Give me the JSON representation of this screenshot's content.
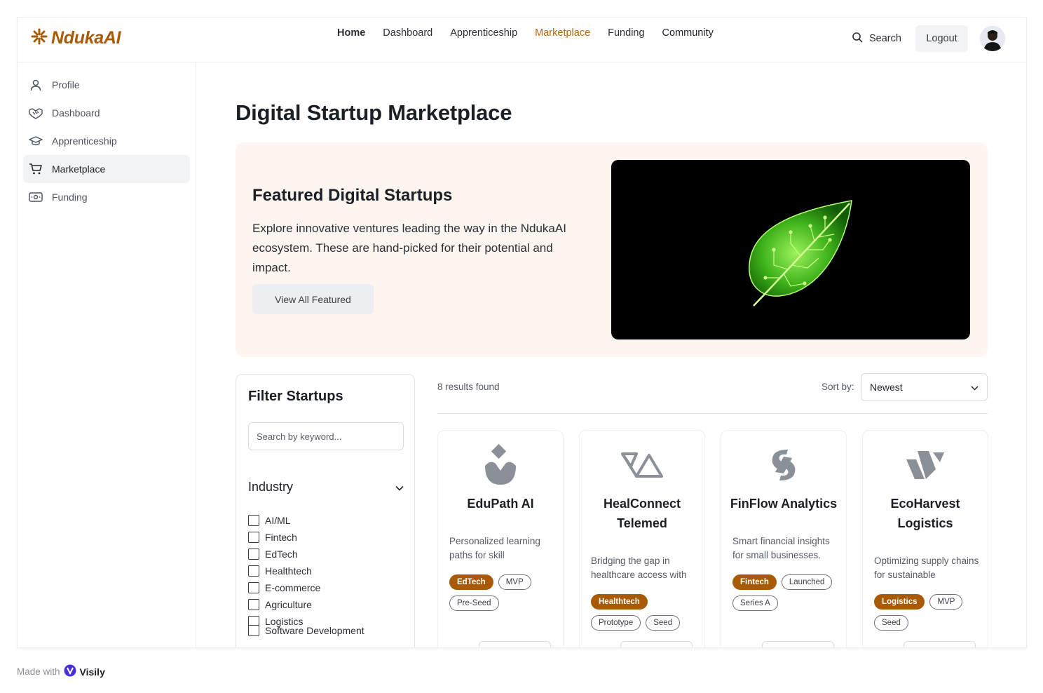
{
  "brand": {
    "name": "NdukaAI",
    "color": "#a85a06"
  },
  "nav": {
    "items": [
      "Home",
      "Dashboard",
      "Apprenticeship",
      "Marketplace",
      "Funding",
      "Community"
    ],
    "active": "Marketplace",
    "search_label": "Search",
    "logout_label": "Logout"
  },
  "sidebar": {
    "items": [
      {
        "label": "Profile",
        "icon": "user-icon"
      },
      {
        "label": "Dashboard",
        "icon": "handshake-icon"
      },
      {
        "label": "Apprenticeship",
        "icon": "graduation-cap-icon"
      },
      {
        "label": "Marketplace",
        "icon": "cart-icon",
        "active": true
      },
      {
        "label": "Funding",
        "icon": "money-icon"
      }
    ]
  },
  "page": {
    "title": "Digital Startup Marketplace"
  },
  "hero": {
    "title": "Featured Digital Startups",
    "description": "Explore innovative ventures leading the way in the NdukaAI ecosystem. These are hand-picked for their potential and impact.",
    "button_label": "View All Featured",
    "image": "circuit-leaf-illustration"
  },
  "filter": {
    "title": "Filter Startups",
    "search_placeholder": "Search by keyword...",
    "industry_label": "Industry",
    "industries": [
      "AI/ML",
      "Fintech",
      "EdTech",
      "Healthtech",
      "E-commerce",
      "Agriculture",
      "Logistics",
      "Software Development"
    ]
  },
  "results": {
    "count_text": "8 results found",
    "sort_label": "Sort by:",
    "sort_value": "Newest"
  },
  "cards": [
    {
      "name": "EduPath AI",
      "description": "Personalized learning paths for skill",
      "tags": [
        "EdTech",
        "MVP",
        "Pre-Seed"
      ],
      "logo": "drop-logo-icon"
    },
    {
      "name": "HealConnect Telemed",
      "description": "Bridging the gap in healthcare access with",
      "tags": [
        "Healthtech",
        "Prototype",
        "Seed"
      ],
      "logo": "triangle-logo-icon"
    },
    {
      "name": "FinFlow Analytics",
      "description": "Smart financial insights for small businesses.",
      "tags": [
        "Fintech",
        "Launched",
        "Series A"
      ],
      "logo": "s-logo-icon"
    },
    {
      "name": "EcoHarvest Logistics",
      "description": "Optimizing supply chains for sustainable",
      "tags": [
        "Logistics",
        "MVP",
        "Seed"
      ],
      "logo": "w-logo-icon"
    }
  ],
  "footer": {
    "made_with": "Made with",
    "tool": "Visily"
  }
}
